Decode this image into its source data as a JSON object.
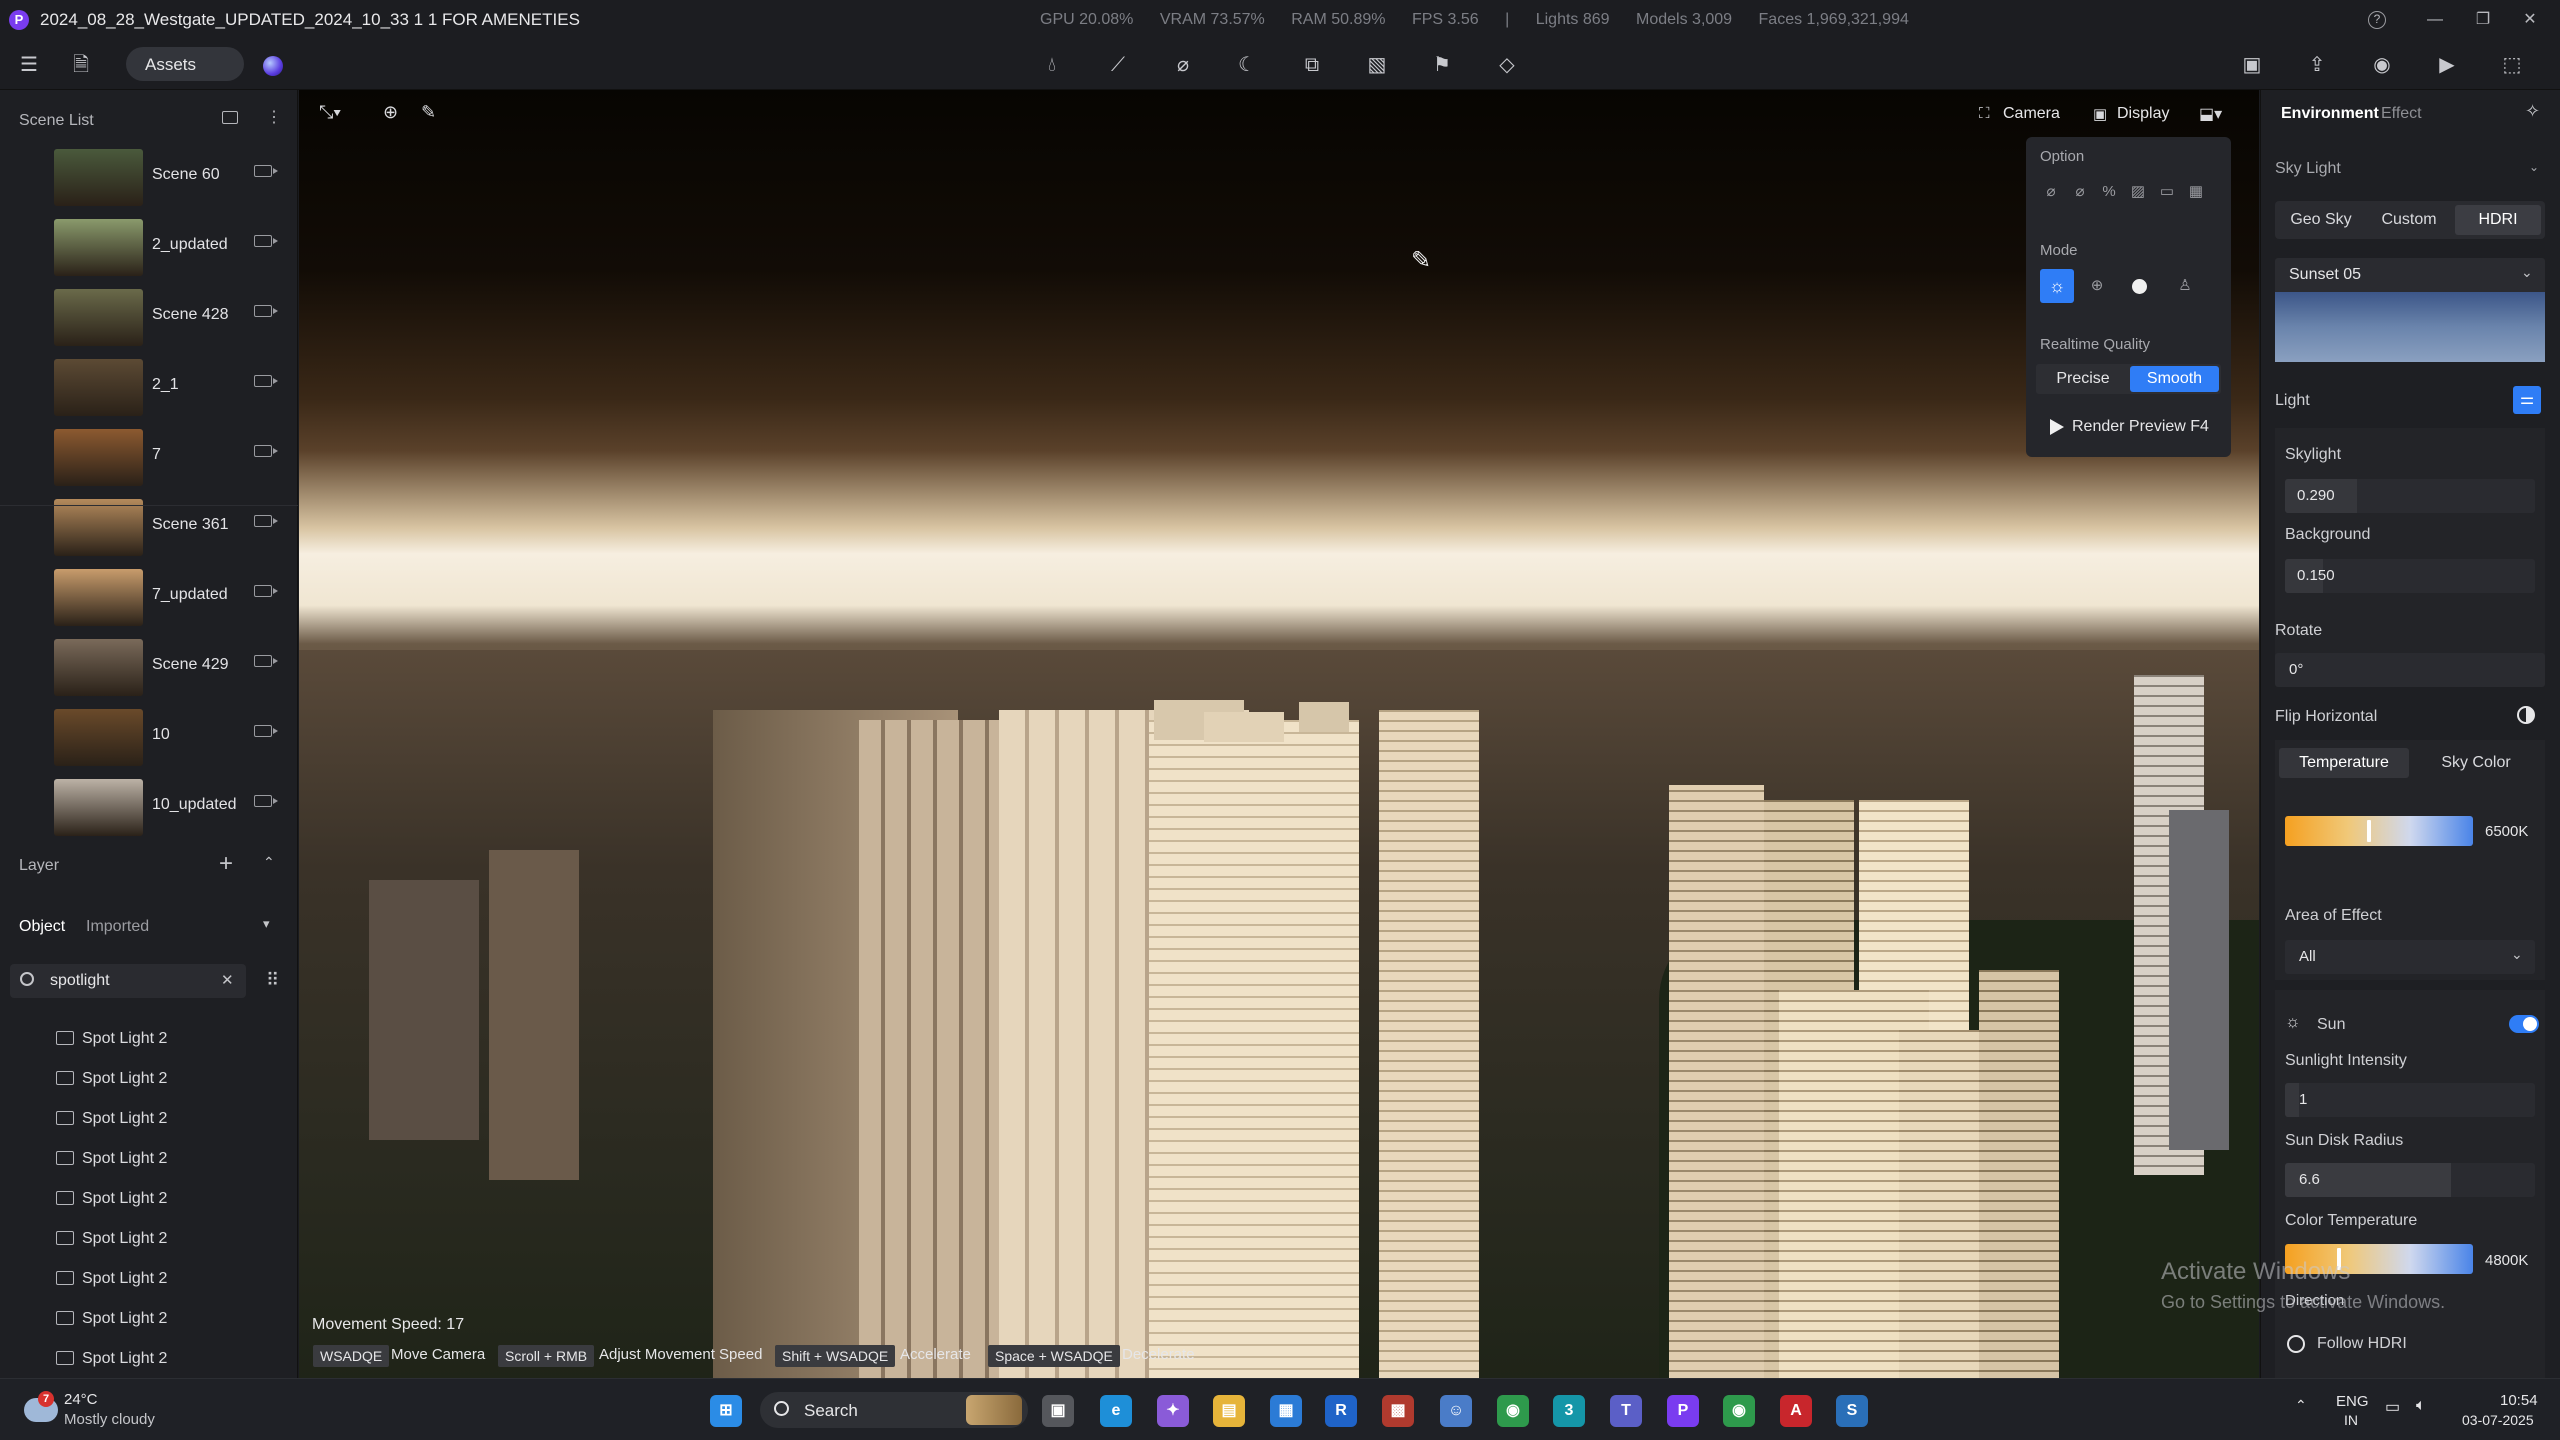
{
  "titlebar": {
    "app_logo": "P",
    "title": "2024_08_28_Westgate_UPDATED_2024_10_33 1 1 FOR AMENETIES",
    "stats": [
      "GPU 20.08%",
      "VRAM 73.57%",
      "RAM 50.89%",
      "FPS 3.56",
      "|",
      "Lights 869",
      "Models 3,009",
      "Faces 1,969,321,994"
    ],
    "help": "?",
    "minimize": "—",
    "restore": "❐",
    "close": "✕"
  },
  "toolbar": {
    "assets_label": "Assets",
    "icons": [
      "menu-icon",
      "file-icon",
      "ai-sparkle-icon",
      "color-orb-icon",
      "material-drop-icon",
      "path-tool-icon",
      "brush-icon",
      "fire-icon",
      "fx-box-icon",
      "sequence-icon",
      "animation-flag-icon",
      "terrain-icon",
      "scene-export-icon",
      "share-icon",
      "camera-snapshot-icon",
      "video-icon",
      "render-icon"
    ]
  },
  "scene_list": {
    "title": "Scene List",
    "scenes": [
      {
        "name": "Scene 60",
        "thumb": "#4a5a3c"
      },
      {
        "name": "2_updated",
        "thumb": "#8a9a6c"
      },
      {
        "name": "Scene 428",
        "thumb": "#6a6a4a"
      },
      {
        "name": "2_1",
        "thumb": "#5c4a34"
      },
      {
        "name": "7",
        "thumb": "#8c5a30"
      },
      {
        "name": "Scene 361",
        "thumb": "#b48a5c"
      },
      {
        "name": "7_updated",
        "thumb": "#c89c6c"
      },
      {
        "name": "Scene 429",
        "thumb": "#7a6a5a"
      },
      {
        "name": "10",
        "thumb": "#6a4a2a"
      },
      {
        "name": "10_updated",
        "thumb": "#bcb2a6"
      }
    ]
  },
  "layer": {
    "title": "Layer",
    "tab_object": "Object",
    "tab_imported": "Imported",
    "search_value": "spotlight",
    "items": [
      "Spot Light 2",
      "Spot Light 2",
      "Spot Light 2",
      "Spot Light 2",
      "Spot Light 2",
      "Spot Light 2",
      "Spot Light 2",
      "Spot Light 2",
      "Spot Light 2"
    ]
  },
  "viewport": {
    "camera_label": "Camera",
    "display_label": "Display",
    "movement_speed": "Movement Speed: 17",
    "hints": [
      {
        "key": "WSADQE",
        "desc": "Move Camera"
      },
      {
        "key": "Scroll + RMB",
        "desc": "Adjust Movement Speed"
      },
      {
        "key": "Shift + WSADQE",
        "desc": "Accelerate"
      },
      {
        "key": "Space + WSADQE",
        "desc": "Decelerate"
      }
    ]
  },
  "option_popup": {
    "option_label": "Option",
    "mode_label": "Mode",
    "quality_label": "Realtime Quality",
    "precise": "Precise",
    "smooth": "Smooth",
    "render_preview": "Render Preview F4"
  },
  "environment": {
    "tab_environment": "Environment",
    "tab_effect": "Effect",
    "sky_light": "Sky Light",
    "geo_sky": "Geo Sky",
    "custom": "Custom",
    "hdri": "HDRI",
    "hdri_preset": "Sunset 05",
    "light": "Light",
    "skylight_label": "Skylight",
    "skylight_value": "0.290",
    "background_label": "Background",
    "background_value": "0.150",
    "rotate_label": "Rotate",
    "rotate_value": "0°",
    "flip_label": "Flip Horizontal",
    "temperature_tab": "Temperature",
    "sky_color_tab": "Sky Color",
    "temperature_value": "6500K",
    "area_label": "Area of Effect",
    "area_value": "All",
    "sun_label": "Sun",
    "sun_enabled": true,
    "sunlight_label": "Sunlight Intensity",
    "sunlight_value": "1",
    "sun_disk_label": "Sun Disk Radius",
    "sun_disk_value": "6.6",
    "color_temp_label": "Color Temperature",
    "color_temp_value": "4800K",
    "direction_label": "Direction",
    "follow_hdri": "Follow HDRI"
  },
  "watermark": {
    "line1": "Activate Windows",
    "line2": "Go to Settings to activate Windows."
  },
  "taskbar": {
    "weather_badge": "7",
    "temperature": "24°C",
    "condition": "Mostly cloudy",
    "search_placeholder": "Search",
    "lang1": "ENG",
    "lang2": "IN",
    "time": "10:54",
    "date": "03-07-2025",
    "apps": [
      {
        "name": "start",
        "glyph": "⊞",
        "color": "#2b8ce6"
      },
      {
        "name": "task-view",
        "glyph": "▣",
        "color": "#55575c"
      },
      {
        "name": "edge",
        "glyph": "e",
        "color": "#1e8fd8"
      },
      {
        "name": "copilot",
        "glyph": "✦",
        "color": "#8a5bd8"
      },
      {
        "name": "explorer",
        "glyph": "▤",
        "color": "#e6b43a"
      },
      {
        "name": "store",
        "glyph": "▦",
        "color": "#2b7bd6"
      },
      {
        "name": "revit",
        "glyph": "R",
        "color": "#1f63c8"
      },
      {
        "name": "media",
        "glyph": "▩",
        "color": "#b03a2e"
      },
      {
        "name": "people",
        "glyph": "☺",
        "color": "#4a7cc8"
      },
      {
        "name": "chrome",
        "glyph": "◉",
        "color": "#2e9a4c"
      },
      {
        "name": "3dsmax",
        "glyph": "3",
        "color": "#1596a8"
      },
      {
        "name": "teams",
        "glyph": "T",
        "color": "#5b5fc7"
      },
      {
        "name": "d5",
        "glyph": "P",
        "color": "#7a3cf0"
      },
      {
        "name": "chrome2",
        "glyph": "◉",
        "color": "#2e9a4c"
      },
      {
        "name": "autocad",
        "glyph": "A",
        "color": "#c8262c"
      },
      {
        "name": "sketchup",
        "glyph": "S",
        "color": "#2a6fb8"
      }
    ]
  }
}
